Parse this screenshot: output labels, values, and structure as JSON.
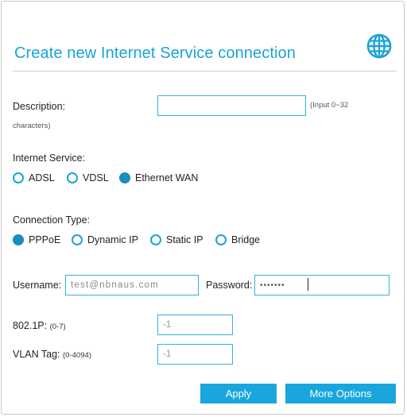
{
  "dialog": {
    "title": "Create new Internet Service connection",
    "icon": "globe-icon",
    "accent_color": "#1aa3d6"
  },
  "description": {
    "label": "Description:",
    "value": "",
    "hint_inline": "(Input 0~32",
    "hint_wrap": "characters)"
  },
  "internet_service": {
    "label": "Internet Service:",
    "options": [
      "ADSL",
      "VDSL",
      "Ethernet WAN"
    ],
    "selected": "Ethernet WAN"
  },
  "connection_type": {
    "label": "Connection Type:",
    "options": [
      "PPPoE",
      "Dynamic IP",
      "Static IP",
      "Bridge"
    ],
    "selected": "PPPoE"
  },
  "credentials": {
    "username_label": "Username:",
    "username_value": "test@nbnaus.com",
    "password_label": "Password:",
    "password_value": "•••••••"
  },
  "priority": {
    "label": "802.1P:",
    "range": "(0-7)",
    "value": "-1"
  },
  "vlan": {
    "label": "VLAN Tag:",
    "range": "(0-4094)",
    "value": "-1"
  },
  "buttons": {
    "apply": "Apply",
    "more_options": "More Options"
  }
}
